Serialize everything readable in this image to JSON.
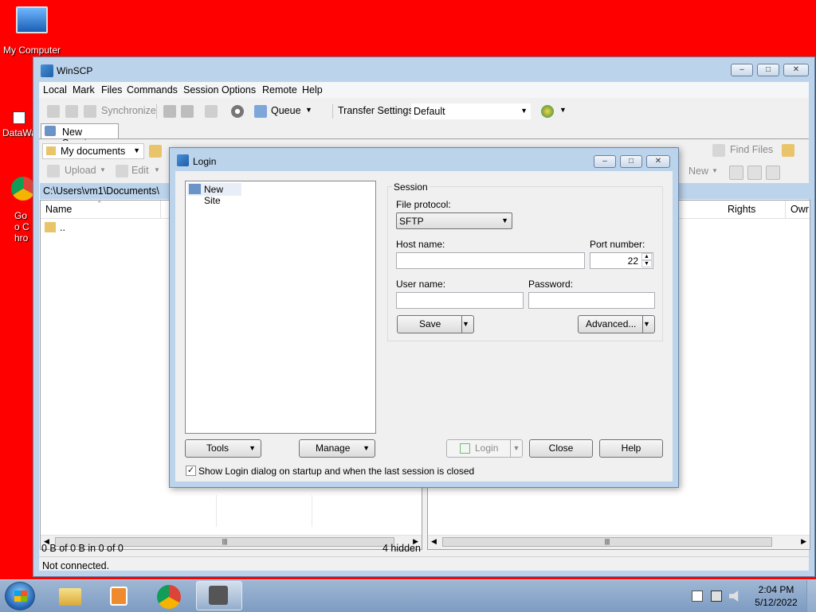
{
  "desktop": {
    "icons": [
      {
        "label": "My Computer"
      },
      {
        "label": "DataWa"
      },
      {
        "label": "Goo Chro"
      }
    ]
  },
  "window": {
    "title": "WinSCP",
    "menu": [
      "Local",
      "Mark",
      "Files",
      "Commands",
      "Session",
      "Options",
      "Remote",
      "Help"
    ],
    "toolbar": {
      "synchronize": "Synchronize",
      "queue": "Queue",
      "transfer_settings_label": "Transfer Settings",
      "transfer_settings_value": "Default"
    },
    "session_tab": "New Session",
    "local": {
      "location": "My documents",
      "upload": "Upload",
      "edit": "Edit",
      "path": "C:\\Users\\vm1\\Documents\\",
      "col_name": "Name",
      "parent_row": ".."
    },
    "remote": {
      "find_files": "Find Files",
      "new": "New",
      "col_rights": "Rights",
      "col_owner": "Owr"
    },
    "status": {
      "selection": "0 B of 0 B in 0 of 0",
      "hidden": "4 hidden",
      "connection": "Not connected."
    }
  },
  "login": {
    "title": "Login",
    "site_tree": [
      "New Site"
    ],
    "session_group": "Session",
    "file_protocol_label": "File protocol:",
    "file_protocol_value": "SFTP",
    "host_label": "Host name:",
    "host_value": "",
    "port_label": "Port number:",
    "port_value": "22",
    "user_label": "User name:",
    "user_value": "",
    "password_label": "Password:",
    "password_value": "",
    "save": "Save",
    "advanced": "Advanced...",
    "tools": "Tools",
    "manage": "Manage",
    "login": "Login",
    "close": "Close",
    "help": "Help",
    "show_on_startup": "Show Login dialog on startup and when the last session is closed",
    "show_on_startup_checked": true
  },
  "taskbar": {
    "time": "2:04 PM",
    "date": "5/12/2022"
  },
  "colors": {
    "desktop": "#ff0000",
    "frame": "#bcd3ec",
    "taskbar": "#8aa6c8"
  }
}
